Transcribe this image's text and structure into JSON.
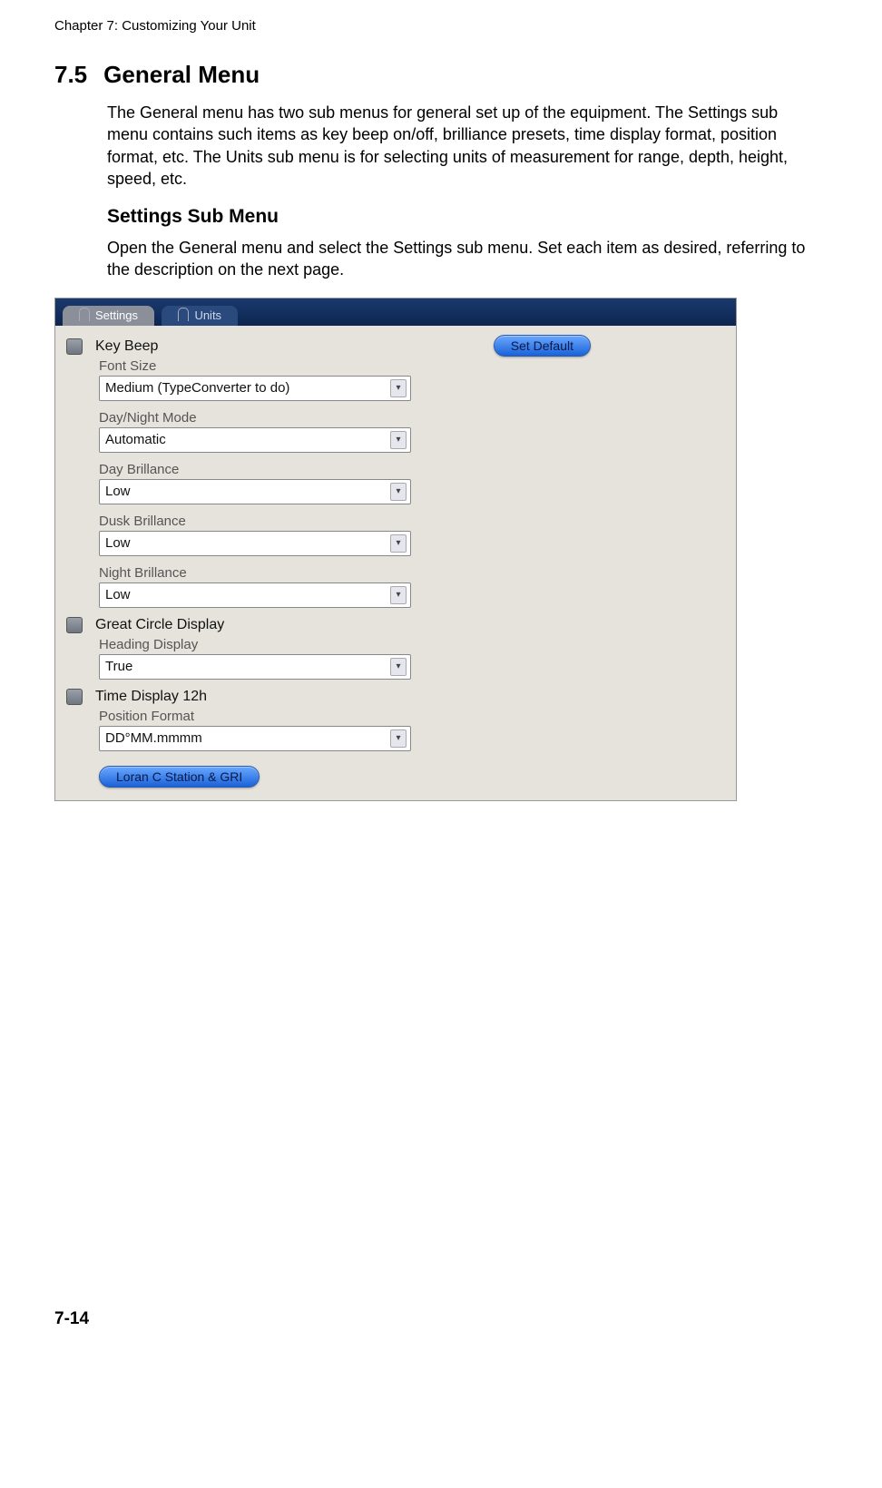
{
  "header": {
    "chapter": "Chapter 7: Customizing Your Unit"
  },
  "section": {
    "number": "7.5",
    "title": "General Menu"
  },
  "para1": "The General menu has two sub menus for general set up of the equipment. The Settings sub menu contains such items as key beep on/off, brilliance presets, time display format, position format, etc. The Units sub menu is for selecting units of measurement for range, depth, height, speed, etc.",
  "sub": {
    "title": "Settings Sub Menu"
  },
  "para2": "Open the General menu and select the Settings sub menu. Set each item as desired, referring to the description on the next page.",
  "shot": {
    "tabs": {
      "settings": "Settings",
      "units": "Units"
    },
    "set_default": "Set Default",
    "key_beep": "Key Beep",
    "font_size": {
      "label": "Font Size",
      "value": "Medium (TypeConverter to do)"
    },
    "day_night": {
      "label": "Day/Night Mode",
      "value": "Automatic"
    },
    "day_brill": {
      "label": "Day Brillance",
      "value": "Low"
    },
    "dusk_brill": {
      "label": "Dusk Brillance",
      "value": "Low"
    },
    "night_brill": {
      "label": "Night Brillance",
      "value": "Low"
    },
    "great_circle": "Great Circle Display",
    "heading": {
      "label": "Heading Display",
      "value": "True"
    },
    "time12": "Time Display 12h",
    "pos_fmt": {
      "label": "Position Format",
      "value": "DD°MM.mmmm"
    },
    "loran": "Loran C Station & GRI"
  },
  "footer": {
    "page": "7-14"
  }
}
